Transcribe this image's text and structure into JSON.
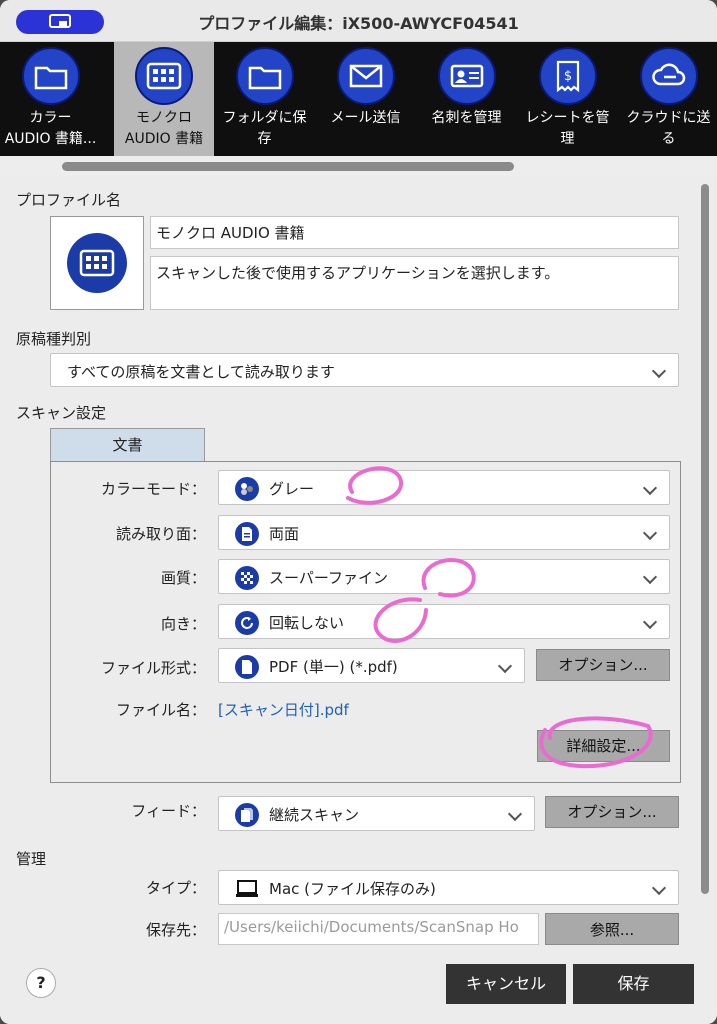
{
  "window": {
    "title": "プロファイル編集：iX500-AWYCF04541"
  },
  "toolbar": {
    "items": [
      {
        "label1": "カラー",
        "label2": "AUDIO 書籍...",
        "icon": "folder-icon"
      },
      {
        "label1": "モノクロ",
        "label2": "AUDIO 書籍",
        "icon": "grid-icon",
        "active": true
      },
      {
        "label1": "フォルダに保",
        "label2": "存",
        "icon": "folder-icon"
      },
      {
        "label1": "メール送信",
        "label2": "",
        "icon": "mail-icon"
      },
      {
        "label1": "名刺を管理",
        "label2": "",
        "icon": "card-icon"
      },
      {
        "label1": "レシートを管",
        "label2": "理",
        "icon": "receipt-icon"
      },
      {
        "label1": "クラウドに送",
        "label2": "る",
        "icon": "cloud-icon"
      }
    ]
  },
  "profile": {
    "section_label": "プロファイル名",
    "name": "モノクロ AUDIO 書籍",
    "description": "スキャンした後で使用するアプリケーションを選択します。"
  },
  "doc_type": {
    "section_label": "原稿種判別",
    "value": "すべての原稿を文書として読み取ります"
  },
  "scan": {
    "section_label": "スキャン設定",
    "tab": "文書",
    "color_mode": {
      "label": "カラーモード：",
      "value": "グレー"
    },
    "side": {
      "label": "読み取り面：",
      "value": "両面"
    },
    "quality": {
      "label": "画質：",
      "value": "スーパーファイン"
    },
    "orientation": {
      "label": "向き：",
      "value": "回転しない"
    },
    "format": {
      "label": "ファイル形式：",
      "value": "PDF (単一) (*.pdf)",
      "option": "オプション..."
    },
    "filename": {
      "label": "ファイル名：",
      "value": "[スキャン日付].pdf"
    },
    "advanced": "詳細設定..."
  },
  "feed": {
    "label": "フィード：",
    "value": "継続スキャン",
    "option": "オプション..."
  },
  "manage": {
    "section_label": "管理",
    "type": {
      "label": "タイプ：",
      "value": "Mac (ファイル保存のみ)"
    },
    "dest": {
      "label": "保存先：",
      "value": "/Users/keiichi/Documents/ScanSnap Ho",
      "browse": "参照..."
    }
  },
  "footer": {
    "help": "?",
    "cancel": "キャンセル",
    "save": "保存"
  }
}
